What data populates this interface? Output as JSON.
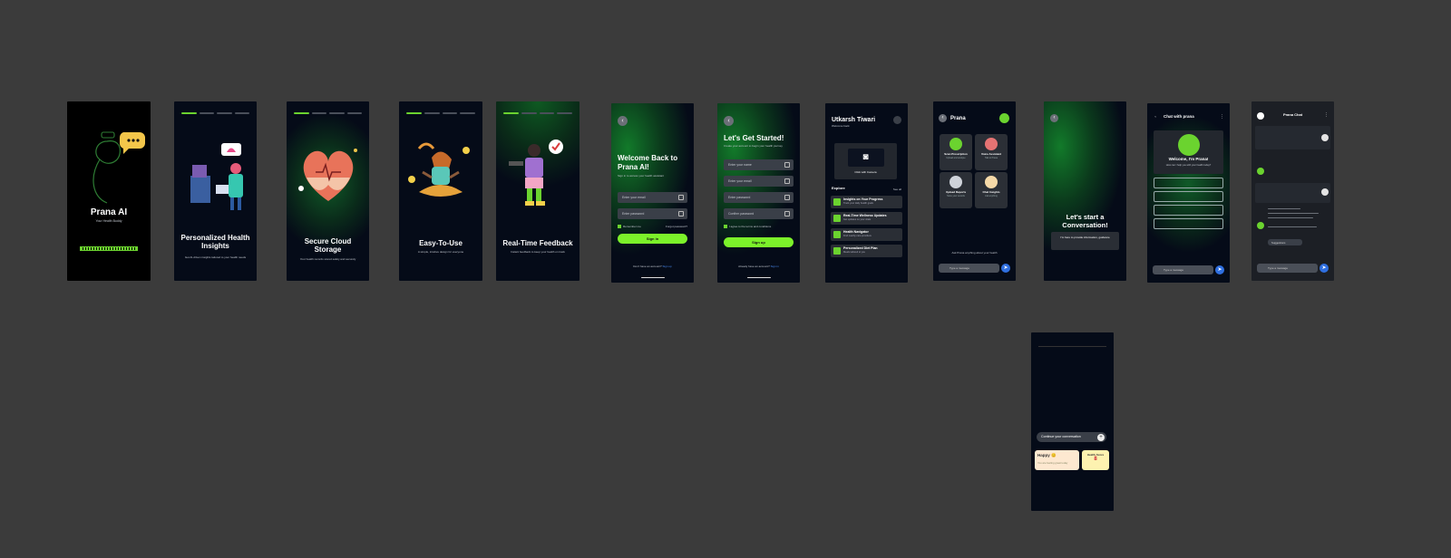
{
  "splash": {
    "title": "Prana AI",
    "tagline": "Your Health Buddy"
  },
  "onboarding": [
    {
      "title": "Personalized Health Insights",
      "desc": "Get AI-driven insights tailored to your health needs"
    },
    {
      "title": "Secure Cloud Storage",
      "desc": "Your health records stored safely and securely"
    },
    {
      "title": "Easy-To-Use",
      "desc": "A simple, intuitive design for everyone"
    },
    {
      "title": "Real-Time Feedback",
      "desc": "Instant feedback to keep your health on track"
    }
  ],
  "login": {
    "title": "Welcome Back to Prana AI!",
    "subtitle": "Sign in to access your health assistant",
    "email_placeholder": "Enter your email",
    "password_placeholder": "Enter password",
    "remember": "Remember me",
    "forgot": "Forgot password?",
    "button": "Sign in",
    "footer": "Don't have an account?",
    "footer_link": "Sign up"
  },
  "signup": {
    "title": "Let's Get Started!",
    "subtitle": "Create your account to begin your health journey",
    "fields": [
      "Enter your name",
      "Enter your email",
      "Enter password",
      "Confirm password"
    ],
    "terms": "I agree to the terms and conditions",
    "button": "Sign up",
    "footer": "Already have an account?",
    "footer_link": "Sign in"
  },
  "home": {
    "name": "Utkarsh Tiwari",
    "greeting": "Welcome back",
    "upload_label": "Click with Camera",
    "explore_label": "Explore",
    "see_all": "See all",
    "explore": [
      {
        "title": "Insights on Your Progress",
        "desc": "Track your daily health goals"
      },
      {
        "title": "Real-Time Wellness Updates",
        "desc": "Get updates on your vitals"
      },
      {
        "title": "Health Navigator",
        "desc": "Find nearby care providers"
      },
      {
        "title": "Personalized Diet Plan",
        "desc": "Meals tailored to you"
      }
    ]
  },
  "prana": {
    "title": "Prana",
    "features": [
      {
        "title": "Scan Prescription",
        "desc": "Upload and analyse"
      },
      {
        "title": "Voice Assistant",
        "desc": "Talk to Prana"
      },
      {
        "title": "Upload Reports",
        "desc": "Store your records"
      },
      {
        "title": "Chat Insights",
        "desc": "Ask anything"
      }
    ],
    "hint": "Ask Prana anything about your health",
    "input_placeholder": "Type a message"
  },
  "start_chat": {
    "title": "Let's start a Conversation!",
    "desc": "I'm here to provide information, guidance"
  },
  "chat": {
    "title": "Chat with prana",
    "welcome": "Welcome, I'm Prana!",
    "welcome_desc": "How can I help you with your health today?",
    "input_placeholder": "Type a message"
  },
  "prana_chat": {
    "title": "Prana Chat",
    "chip": "Suggestions",
    "input_placeholder": "Type a message"
  },
  "mood": {
    "continue": "Continue your conversation",
    "card1_title": "Happy 😊",
    "card1_desc": "You are feeling great today",
    "card2_title": "Health Score",
    "card2_value": "8"
  },
  "colors": {
    "accent": "#7cf22a",
    "bg": "#050b18",
    "canvas": "#3b3b3b",
    "link": "#2f6fe0"
  }
}
